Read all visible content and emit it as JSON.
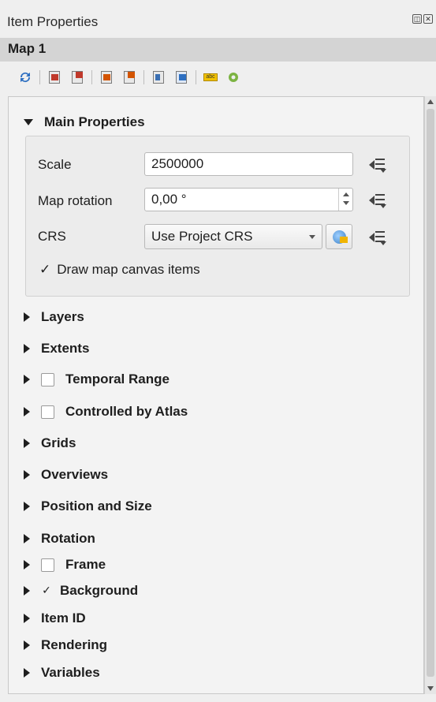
{
  "window": {
    "title": "Item Properties"
  },
  "item": {
    "name": "Map 1"
  },
  "main": {
    "header": "Main Properties",
    "scale_label": "Scale",
    "scale_value": "2500000",
    "rotation_label": "Map rotation",
    "rotation_value": "0,00 °",
    "crs_label": "CRS",
    "crs_value": "Use Project CRS",
    "draw_items_label": "Draw map canvas items",
    "draw_items_checked": true,
    "check_mark": "✓"
  },
  "sections": {
    "layers": "Layers",
    "extents": "Extents",
    "temporal": "Temporal Range",
    "atlas": "Controlled by Atlas",
    "grids": "Grids",
    "overviews": "Overviews",
    "position": "Position and Size",
    "rotation": "Rotation",
    "frame": "Frame",
    "background": "Background",
    "item_id": "Item ID",
    "rendering": "Rendering",
    "variables": "Variables"
  },
  "checkboxes": {
    "temporal_checked": false,
    "atlas_checked": false,
    "frame_checked": false,
    "background_checked": true
  },
  "icons": {
    "toolbar": [
      "refresh-icon",
      "set-extent-to-canvas-icon",
      "view-extent-in-canvas-icon",
      "set-to-atlas-icon",
      "view-atlas-icon",
      "bookmark-icon",
      "layout-canvas-icon",
      "label-settings-icon",
      "layer-settings-icon"
    ],
    "title_buttons": [
      "float-icon",
      "close-icon"
    ]
  }
}
